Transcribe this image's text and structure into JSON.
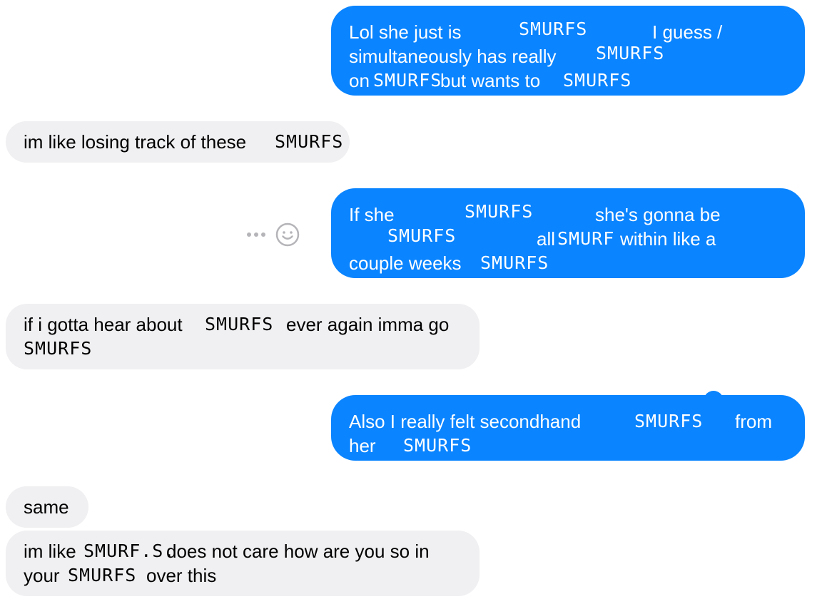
{
  "conversation": {
    "messages": [
      {
        "direction": "sent",
        "lines": [
          [
            "Lol she just is",
            "SMURFS",
            "I guess /"
          ],
          [
            "simultaneously has really",
            "SMURFS"
          ],
          [
            "on",
            "SMURFS",
            "but wants to",
            "SMURFS"
          ]
        ]
      },
      {
        "direction": "received",
        "lines": [
          [
            "im like losing track of these",
            "SMURFS"
          ]
        ]
      },
      {
        "direction": "sent",
        "lines": [
          [
            "If she",
            "SMURFS",
            "she's gonna be"
          ],
          [
            "SMURFS",
            "all",
            "SMURF",
            "within like a"
          ],
          [
            "couple weeks",
            "SMURFS"
          ]
        ]
      },
      {
        "direction": "received",
        "lines": [
          [
            "if i gotta hear about",
            "SMURFS",
            "ever again imma go"
          ],
          [
            "SMURFS"
          ]
        ]
      },
      {
        "direction": "sent",
        "lines": [
          [
            "Also I really felt secondhand",
            "SMURFS",
            "from"
          ],
          [
            "her",
            "SMURFS"
          ]
        ]
      },
      {
        "direction": "received",
        "lines": [
          [
            "same"
          ]
        ]
      },
      {
        "direction": "received",
        "lines": [
          [
            "im like",
            "SMURF.S.",
            "does not care how are you so in"
          ],
          [
            "your",
            "SMURFS",
            "over this"
          ]
        ]
      }
    ]
  },
  "actions": {
    "more_icon": "more-dots-icon",
    "react_icon": "smiley-icon"
  },
  "colors": {
    "sent_bubble": "#0a84ff",
    "received_bubble": "#f0eff1",
    "icon_gray": "#b5b5b9"
  }
}
